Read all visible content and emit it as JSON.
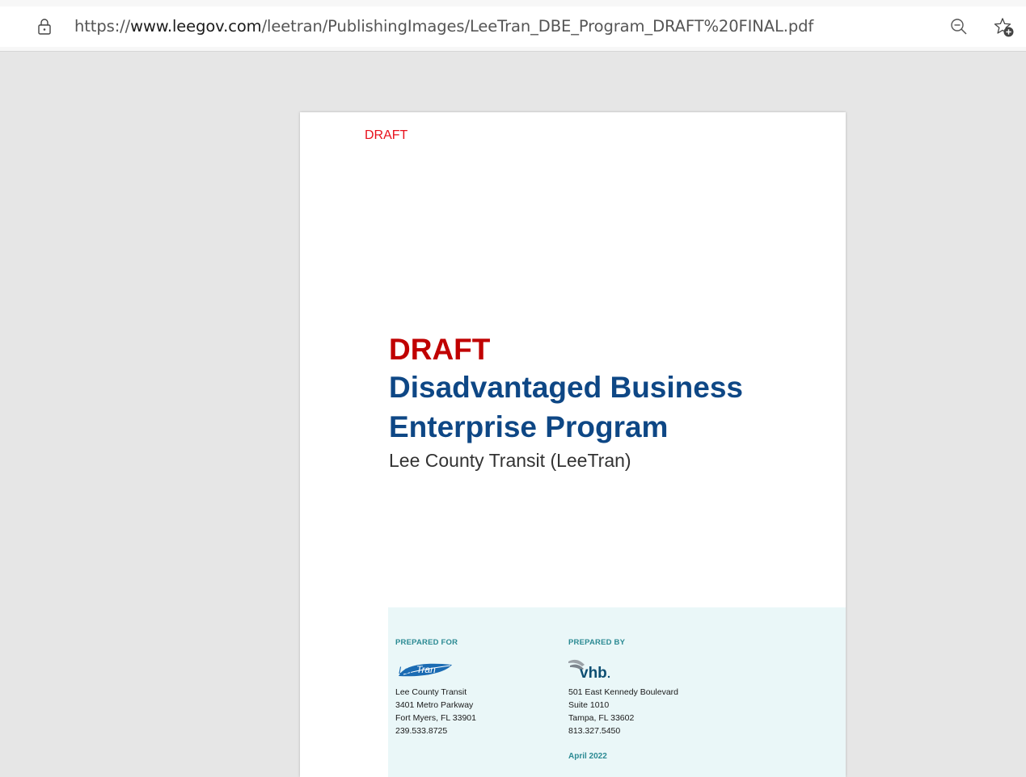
{
  "browser": {
    "url_prefix": "https://",
    "url_domain": "www.leegov.com",
    "url_path": "/leetran/PublishingImages/LeeTran_DBE_Program_DRAFT%20FINAL.pdf",
    "icons": [
      "lock-icon",
      "zoom-out-icon",
      "add-favorite-icon"
    ]
  },
  "document": {
    "header_mark": "DRAFT",
    "title_draft": "DRAFT",
    "title_main": "Disadvantaged Business Enterprise Program",
    "subtitle": "Lee County Transit (LeeTran)",
    "prepared_for": {
      "label": "PREPARED FOR",
      "logo_text": "LeeTran",
      "lines": [
        "Lee County Transit",
        "3401 Metro Parkway",
        "Fort Myers, FL 33901",
        "239.533.8725"
      ]
    },
    "prepared_by": {
      "label": "PREPARED BY",
      "logo_text": "vhb",
      "lines": [
        "501 East Kennedy Boulevard",
        "Suite 1010",
        "Tampa, FL 33602",
        "813.327.5450"
      ],
      "date": "April 2022"
    },
    "colors": {
      "draft_red": "#c00000",
      "title_blue": "#0e4785",
      "teal": "#2b8a93",
      "panel_bg": "#eaf7f8"
    }
  }
}
